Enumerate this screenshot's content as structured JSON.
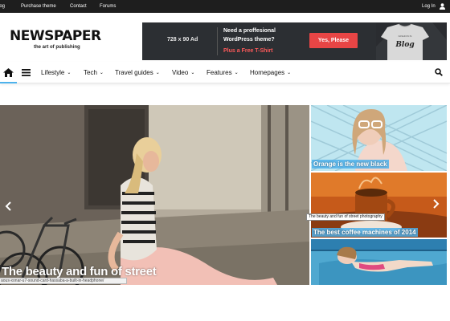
{
  "topbar": {
    "links": [
      "log",
      "Purchase theme",
      "Contact",
      "Forums"
    ],
    "login": "Log In"
  },
  "logo": {
    "name": "NEWSPAPER",
    "tagline": "the art of publishing"
  },
  "ad": {
    "size": "728 x 90 Ad",
    "headline_1": "Need a proffesional",
    "headline_2": "WordPress theme?",
    "offer": "Plus a Free T-Shirt",
    "button": "Yes, Please"
  },
  "nav": {
    "items": [
      {
        "label": "Lifestyle"
      },
      {
        "label": "Tech"
      },
      {
        "label": "Travel guides"
      },
      {
        "label": "Video"
      },
      {
        "label": "Features"
      },
      {
        "label": "Homepages"
      }
    ]
  },
  "hero": {
    "title": "The beauty and fun of street",
    "status_url": "aous-xonar-u7-sound-card-hassaba-a-built-in-headphone/"
  },
  "side": [
    {
      "title": "Orange is the new black"
    },
    {
      "title": "The best coffee machines of 2014",
      "tooltip": "The beauty and fun of street photography"
    },
    {
      "title": ""
    }
  ],
  "colors": {
    "accent": "#4db2ec",
    "topbar": "#1e1e1e",
    "ad_button": "#e84545"
  }
}
